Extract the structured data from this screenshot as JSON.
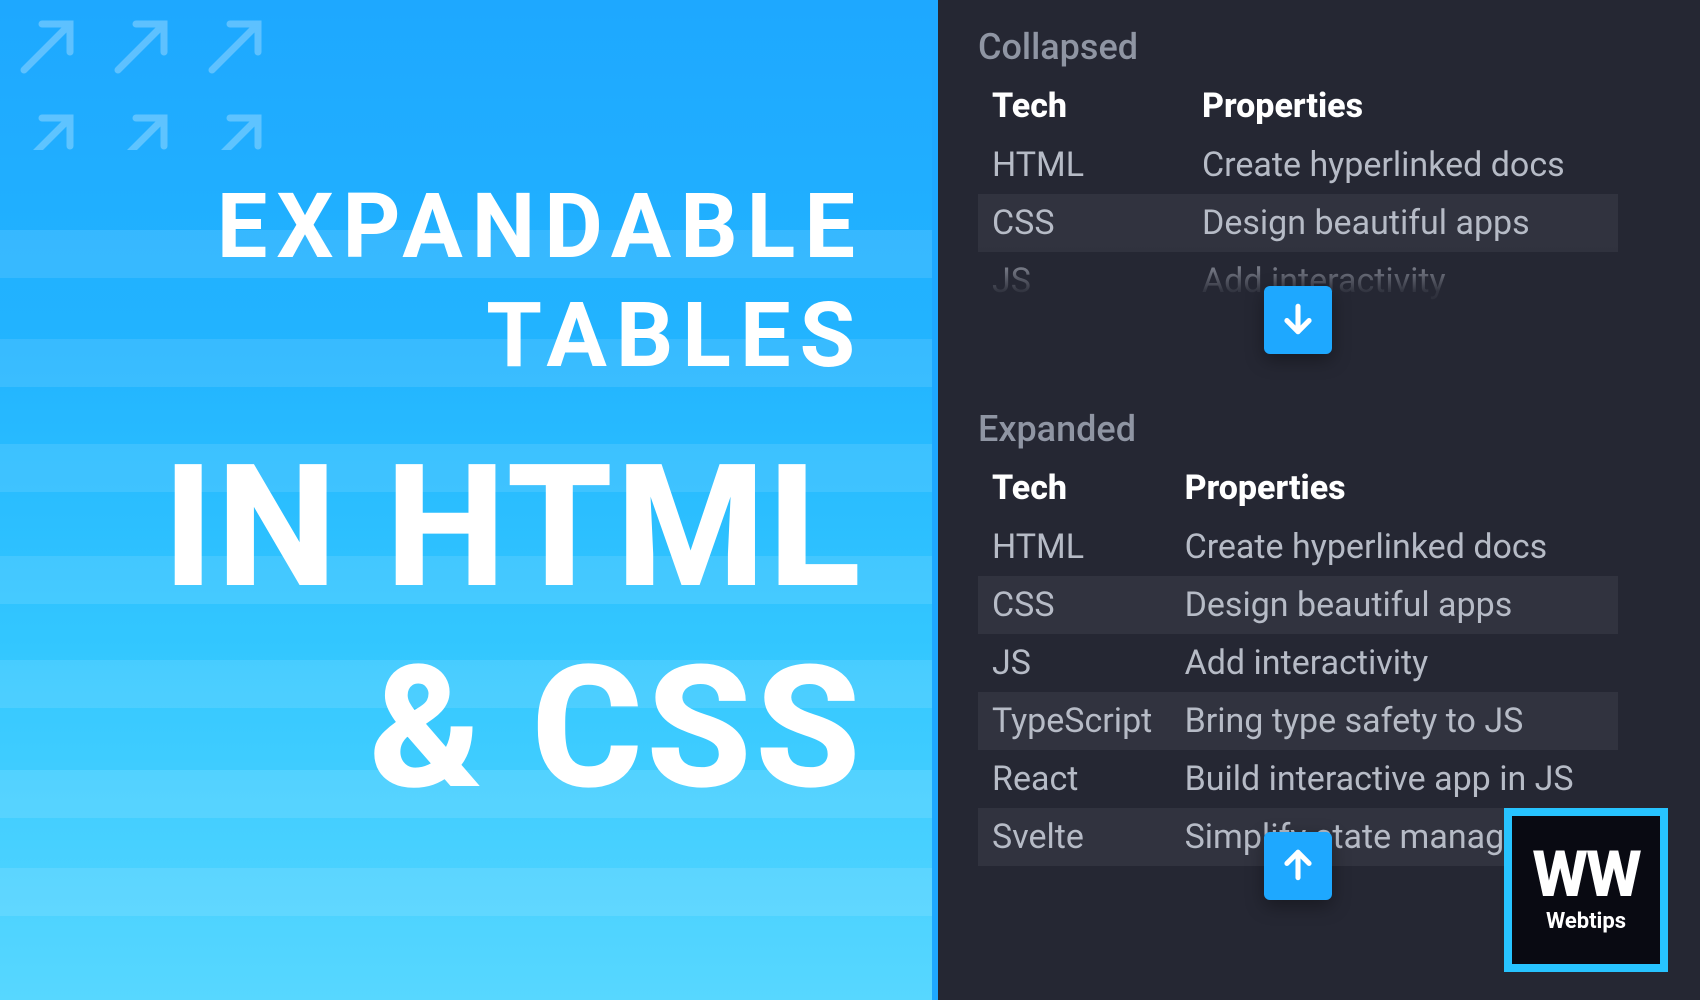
{
  "hero": {
    "line1": "EXPANDABLE",
    "line2": "TABLES",
    "line3": "IN HTML",
    "line4": "& CSS"
  },
  "collapsed": {
    "title": "Collapsed",
    "headers": {
      "col1": "Tech",
      "col2": "Properties"
    },
    "rows": [
      {
        "tech": "HTML",
        "prop": "Create hyperlinked docs"
      },
      {
        "tech": "CSS",
        "prop": "Design beautiful apps"
      },
      {
        "tech": "JS",
        "prop": "Add interactivity"
      }
    ]
  },
  "expanded": {
    "title": "Expanded",
    "headers": {
      "col1": "Tech",
      "col2": "Properties"
    },
    "rows": [
      {
        "tech": "HTML",
        "prop": "Create hyperlinked docs"
      },
      {
        "tech": "CSS",
        "prop": "Design beautiful apps"
      },
      {
        "tech": "JS",
        "prop": "Add interactivity"
      },
      {
        "tech": "TypeScript",
        "prop": "Bring type safety to JS"
      },
      {
        "tech": "React",
        "prop": "Build interactive app in JS"
      },
      {
        "tech": "Svelte",
        "prop": "Simplify state management"
      }
    ]
  },
  "logo": {
    "mark": "WW",
    "label": "Webtips"
  },
  "stripe_tops": [
    230,
    339,
    444,
    556,
    660,
    770,
    868
  ],
  "colors": {
    "accent": "#1ea8ff",
    "panel_bg": "#252733",
    "row_alt": "#31333f"
  }
}
